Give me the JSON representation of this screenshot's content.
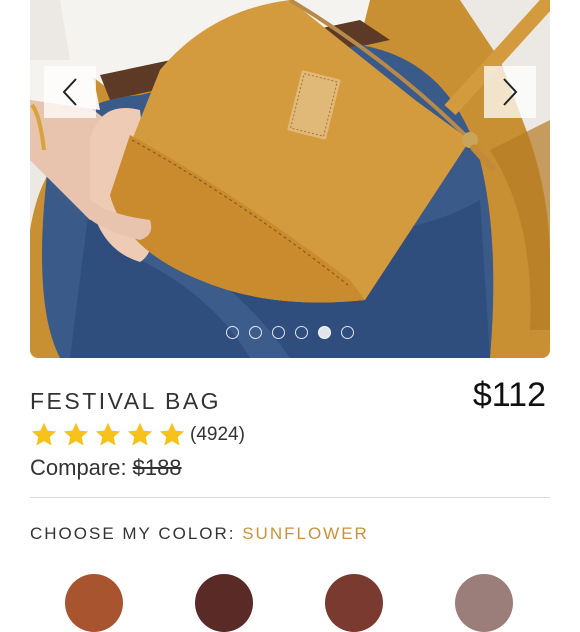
{
  "gallery": {
    "dots": [
      false,
      false,
      false,
      false,
      true,
      false
    ],
    "prev_icon": "chevron-left-icon",
    "next_icon": "chevron-right-icon"
  },
  "product": {
    "name": "FESTIVAL BAG",
    "price": "$112",
    "rating": 5,
    "review_count": "(4924)",
    "compare_label": "Compare:",
    "compare_price": "$188",
    "star_color": "#f7c31b"
  },
  "color_picker": {
    "label": "CHOOSE MY COLOR: ",
    "selected": "SUNFLOWER",
    "accent": "#c8933a",
    "swatch_colors": [
      "#a8552f",
      "#5a2a26",
      "#7a3a30",
      "#9b7e7a"
    ]
  }
}
